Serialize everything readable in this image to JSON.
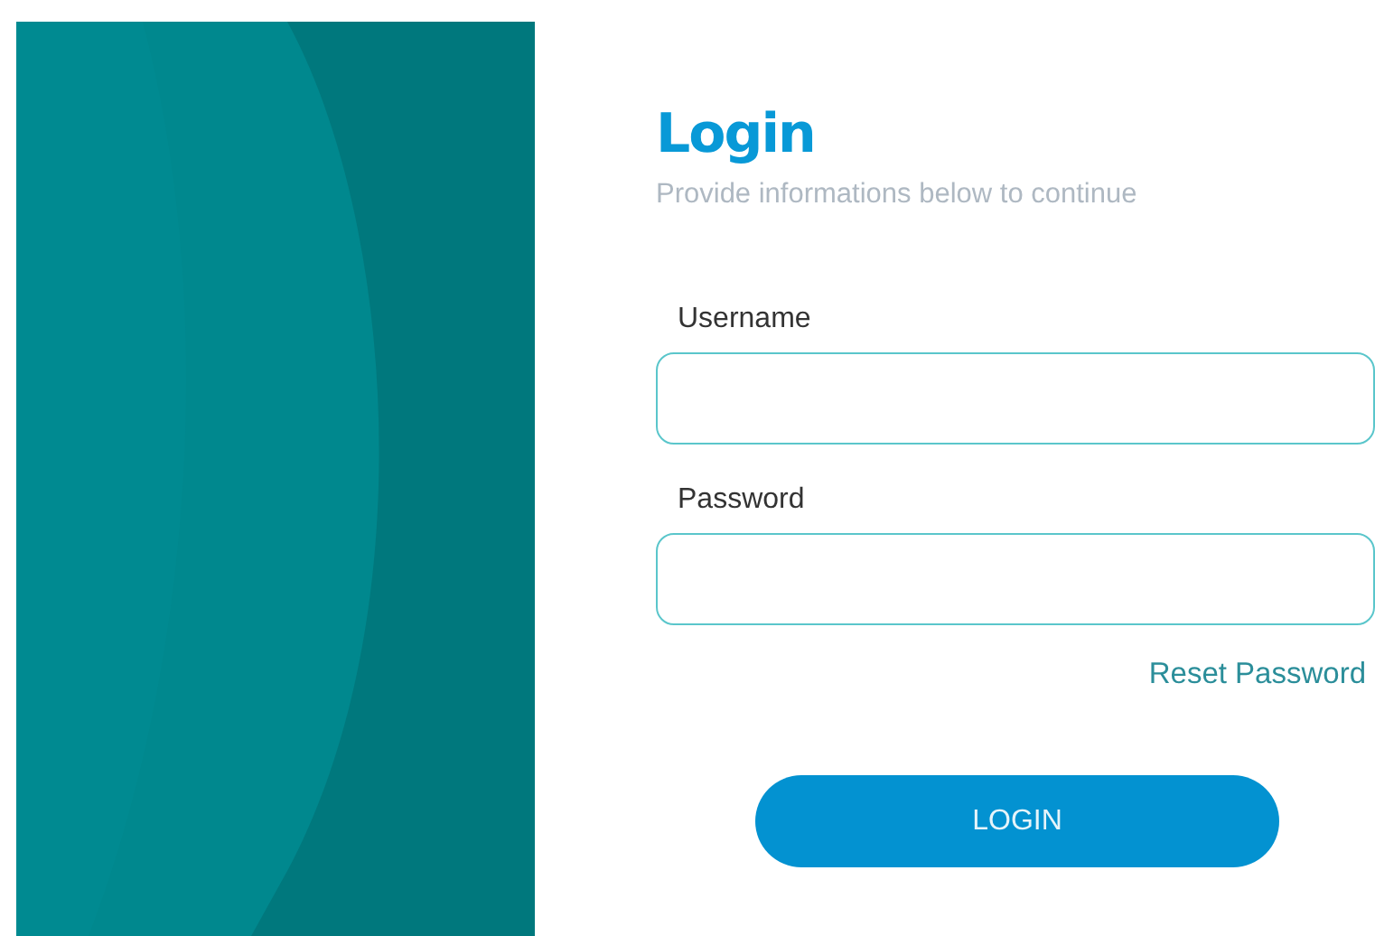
{
  "title": "Login",
  "subtitle": "Provide informations below to continue",
  "fields": [
    {
      "label": "Username"
    },
    {
      "label": "Password"
    }
  ],
  "reset_link": "Reset Password",
  "login_button": "LOGIN"
}
